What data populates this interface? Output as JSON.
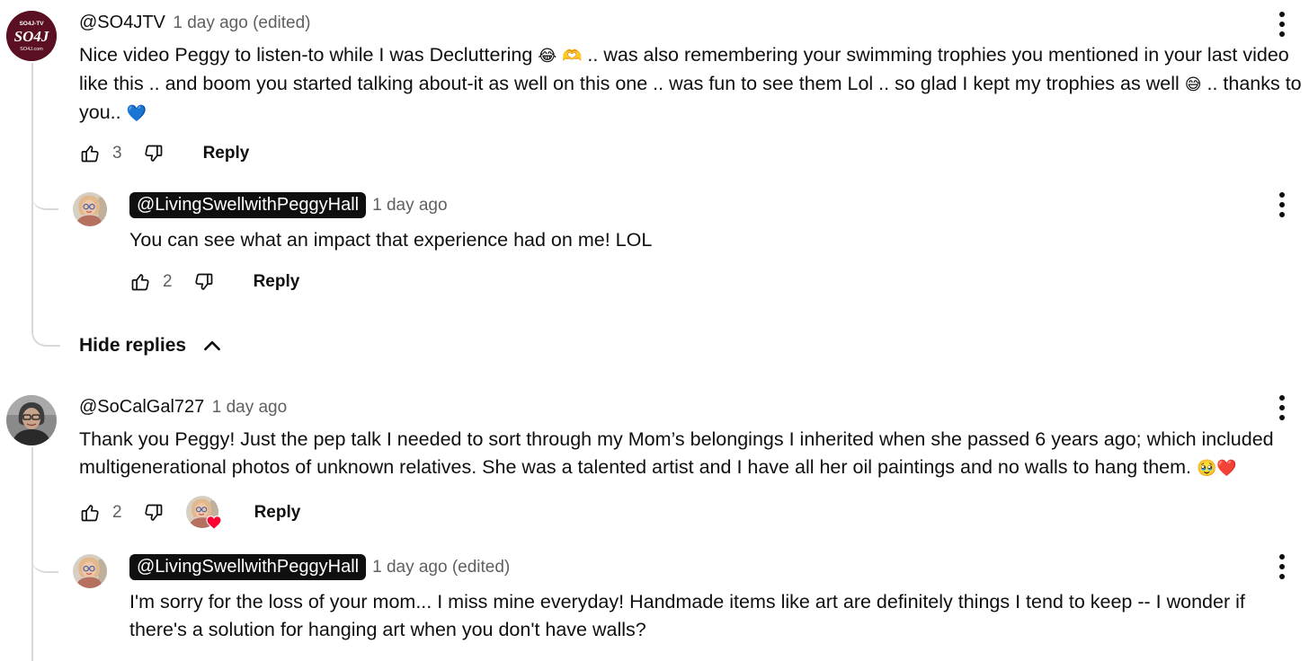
{
  "comments": [
    {
      "handle": "@SO4JTV",
      "time": "1 day ago (edited)",
      "avatar_lines": [
        "SO4J-TV",
        "SO4J",
        "SO4J.com"
      ],
      "text_a": "Nice video Peggy to listen-to while I was Decluttering ",
      "emoji_1": "😂 🫶",
      "text_b": " .. was also remembering your swimming trophies you mentioned in your last video like this .. and boom you started talking about-it as well on this one .. was fun to see them Lol .. so glad I kept my trophies  as well ",
      "emoji_2": "😅",
      "text_c": " .. thanks to you.. ",
      "emoji_3": "💙",
      "likes": "3",
      "reply_label": "Reply",
      "replies": [
        {
          "handle": "@LivingSwellwithPeggyHall",
          "time": "1 day ago",
          "text": "You can see what an impact that experience had on me! LOL",
          "likes": "2",
          "reply_label": "Reply"
        }
      ],
      "hide_replies_label": "Hide replies"
    },
    {
      "handle": "@SoCalGal727",
      "time": "1 day ago",
      "text_a": "Thank you Peggy! Just the pep talk I needed to sort through my Mom’s belongings I inherited when she passed 6 years ago; which included multigenerational photos of unknown relatives. She was a talented artist and I have all her oil paintings and no walls to hang them. ",
      "emoji_1": "🥹❤️",
      "likes": "2",
      "reply_label": "Reply",
      "replies": [
        {
          "handle": "@LivingSwellwithPeggyHall",
          "time": "1 day ago (edited)",
          "text": "I'm sorry for the loss of your mom... I miss mine everyday! Handmade items like art are definitely things I tend to keep -- I wonder if there's a solution for hanging art when you don't have walls?"
        }
      ]
    }
  ],
  "icons": {
    "like": "thumbs-up-icon",
    "dislike": "thumbs-down-icon",
    "more": "more-vert-icon",
    "chevron": "chevron-up-icon",
    "heart_badge": "creator-heart-icon"
  },
  "colors": {
    "heart": "#ff0033",
    "so4j_bg": "#5a0f22",
    "text_secondary": "#606060"
  }
}
